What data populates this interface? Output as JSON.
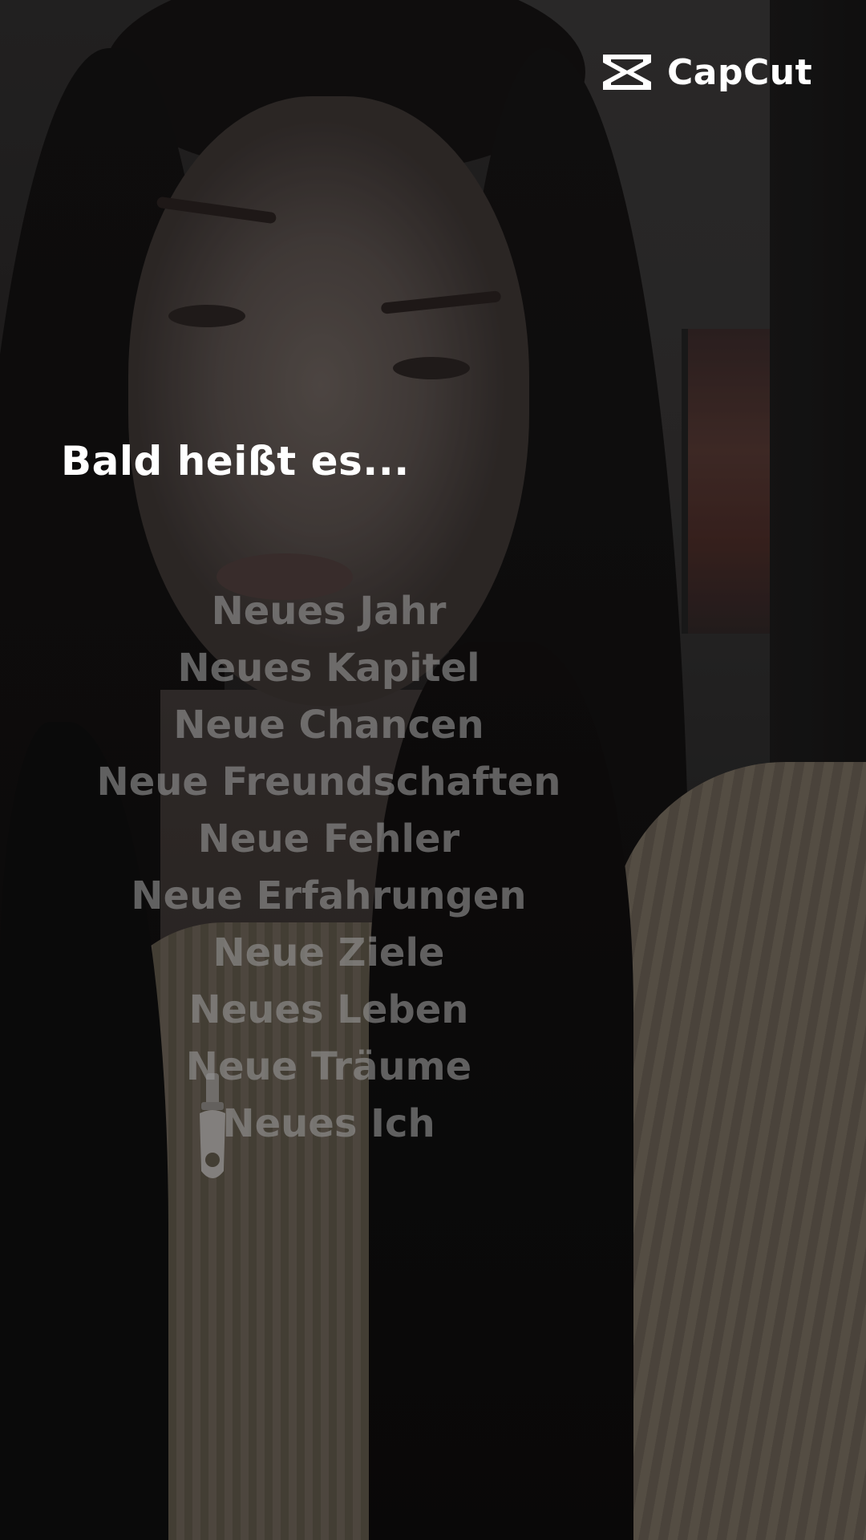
{
  "watermark": {
    "brand": "CapCut",
    "icon": "capcut-logo-icon"
  },
  "overlay": {
    "headline": "Bald heißt es...",
    "lines": [
      "Neues Jahr",
      "Neues Kapitel",
      "Neue Chancen",
      "Neue Freundschaften",
      "Neue Fehler",
      "Neue Erfahrungen",
      "Neue Ziele",
      "Neues Leben",
      "Neue Träume",
      "Neues Ich"
    ]
  },
  "colors": {
    "headline": "#ffffff",
    "lines": "#969696",
    "watermark": "#ffffff"
  }
}
